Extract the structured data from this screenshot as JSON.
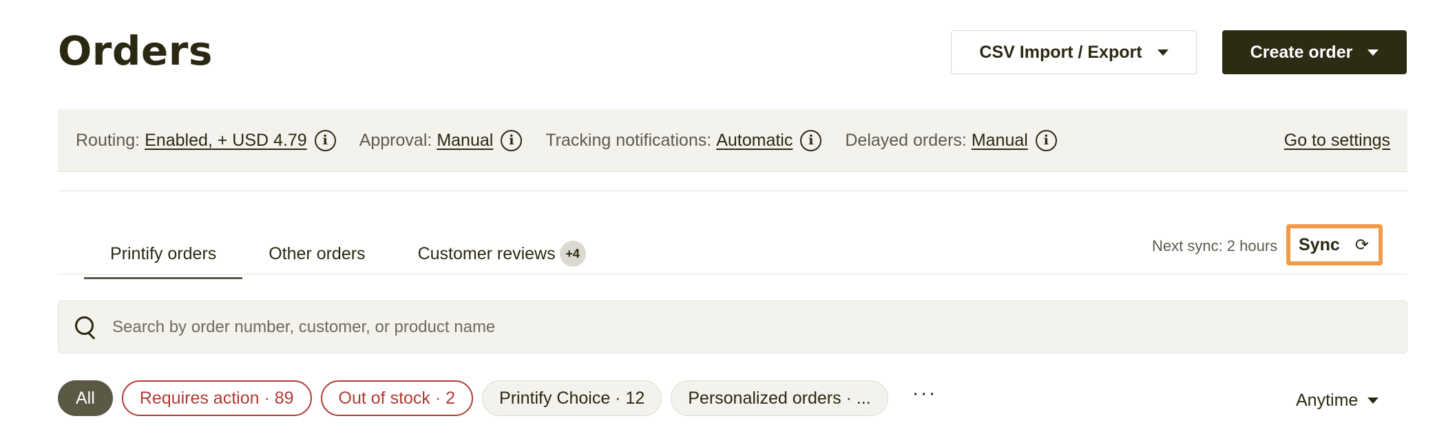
{
  "header": {
    "title": "Orders",
    "csv_button": "CSV Import / Export",
    "create_button": "Create order"
  },
  "settings": {
    "items": [
      {
        "label": "Routing:",
        "value": "Enabled, + USD 4.79"
      },
      {
        "label": "Approval:",
        "value": "Manual"
      },
      {
        "label": "Tracking notifications:",
        "value": "Automatic"
      },
      {
        "label": "Delayed orders:",
        "value": "Manual"
      }
    ],
    "go_to_settings": "Go to settings"
  },
  "tabs": [
    {
      "label": "Printify orders",
      "active": true
    },
    {
      "label": "Other orders",
      "active": false
    },
    {
      "label": "Customer reviews",
      "badge": "+4",
      "active": false
    }
  ],
  "sync": {
    "next_sync": "Next sync: 2 hours",
    "button": "Sync",
    "highlight_color": "#f29a4a"
  },
  "search": {
    "placeholder": "Search by order number, customer, or product name"
  },
  "filters": {
    "chips": [
      {
        "label": "All"
      },
      {
        "label": "Requires action · 89"
      },
      {
        "label": "Out of stock · 2"
      },
      {
        "label": "Printify Choice · 12"
      },
      {
        "label": "Personalized orders · ..."
      }
    ],
    "more": "···",
    "date_filter": "Anytime"
  }
}
